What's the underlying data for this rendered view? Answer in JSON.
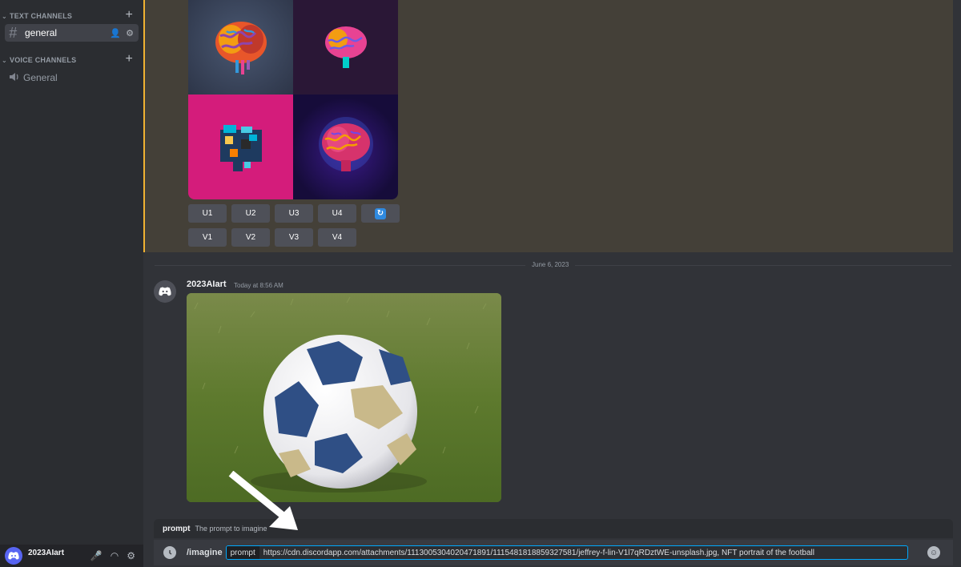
{
  "sidebar": {
    "text_category": "TEXT CHANNELS",
    "voice_category": "VOICE CHANNELS",
    "text_channels": [
      {
        "name": "general",
        "icon": "hash-icon"
      }
    ],
    "voice_channels": [
      {
        "name": "General",
        "icon": "speaker-icon"
      }
    ],
    "user": {
      "name": "2023AIart"
    }
  },
  "image_grid": {
    "upscale_buttons": [
      "U1",
      "U2",
      "U3",
      "U4"
    ],
    "variation_buttons": [
      "V1",
      "V2",
      "V3",
      "V4"
    ],
    "refresh_icon": "refresh-icon"
  },
  "chat": {
    "date_divider": "June 6, 2023",
    "message": {
      "author": "2023AIart",
      "timestamp": "Today at 8:56 AM"
    }
  },
  "command": {
    "option_name": "prompt",
    "option_description": "The prompt to imagine",
    "command_name": "/imagine",
    "field_label": "prompt",
    "field_value": "https://cdn.discordapp.com/attachments/1113005304020471891/1115481818859327581/jeffrey-f-lin-V1l7qRDztWE-unsplash.jpg, NFT portrait of the football"
  },
  "colors": {
    "highlight_border": "#f0b232",
    "field_border": "#00a8fc",
    "accent": "#5865f2"
  }
}
